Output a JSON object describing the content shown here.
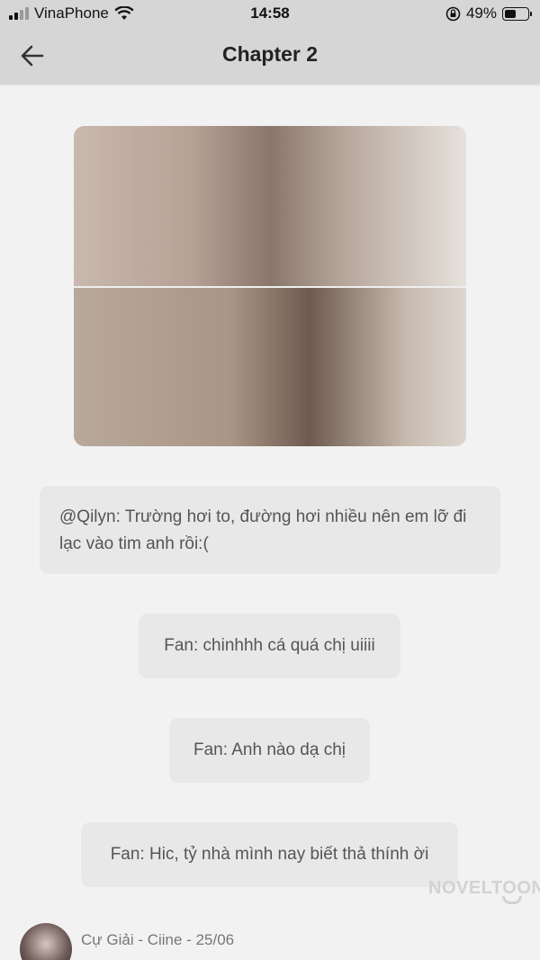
{
  "status_bar": {
    "carrier": "VinaPhone",
    "time": "14:58",
    "battery_percent": "49%",
    "battery_level": 0.49
  },
  "header": {
    "title": "Chapter 2"
  },
  "messages": [
    {
      "text": "@Qilyn: Trường hơi to, đường hơi nhiều nên em lỡ đi lạc vào tim anh rồi:("
    },
    {
      "text": "Fan: chinhhh cá quá chị uiiii"
    },
    {
      "text": "Fan: Anh nào dạ chị"
    },
    {
      "text": "Fan: Hic, tỷ nhà mình nay biết thả thính ời"
    }
  ],
  "watermark": "NOVELTOON",
  "author_line": "Cự Giải - Ciine - 25/06"
}
